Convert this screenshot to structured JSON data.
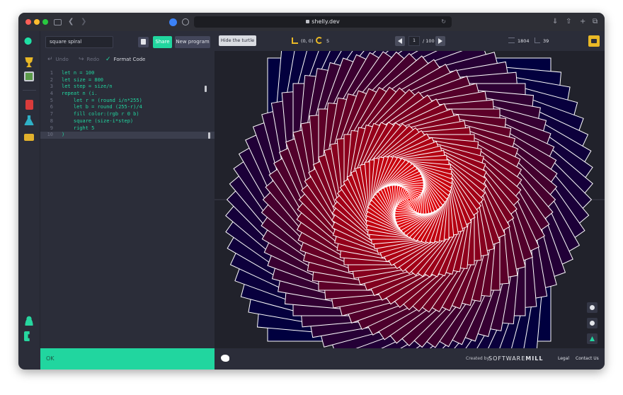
{
  "browser": {
    "url": "shelly.dev"
  },
  "editor": {
    "program_name": "square spiral",
    "share_label": "Share",
    "new_program_label": "New program",
    "undo_label": "Undo",
    "redo_label": "Redo",
    "format_label": "Format Code",
    "lines": [
      {
        "no": "1",
        "text": "let n = 100"
      },
      {
        "no": "2",
        "text": "let size = 800"
      },
      {
        "no": "3",
        "text": "let step = size/n"
      },
      {
        "no": "4",
        "text": "repeat n (i."
      },
      {
        "no": "5",
        "text": "    let r = (round i/n*255)"
      },
      {
        "no": "6",
        "text": "    let b = round (255-r)/4"
      },
      {
        "no": "7",
        "text": "    fill color:(rgb r 0 b)"
      },
      {
        "no": "8",
        "text": "    square (size-i*step)"
      },
      {
        "no": "9",
        "text": "    right 5"
      },
      {
        "no": "10",
        "text": ")"
      }
    ],
    "status": "OK"
  },
  "canvas": {
    "hide_turtle_label": "Hide the turtle",
    "position": "(0, 0)",
    "heading": "5",
    "frame_current": "1",
    "frame_total": "/ 100",
    "lines_count": "1804",
    "time_count": "39",
    "spiral": {
      "count": 100,
      "start_size": 800,
      "step": 8,
      "angle_step_deg": 5,
      "color_start": "#00003f",
      "color_end": "#ff0000",
      "stroke_color": "#ffffff"
    }
  },
  "footer": {
    "created_by": "Created by",
    "company_prefix": "SOFTWARE",
    "company_suffix": "MILL",
    "legal": "Legal",
    "contact": "Contact Us"
  },
  "colors": {
    "accent": "#21d69f",
    "panel": "#2b2d39",
    "canvas": "#21222b",
    "yellow": "#e9b826"
  }
}
